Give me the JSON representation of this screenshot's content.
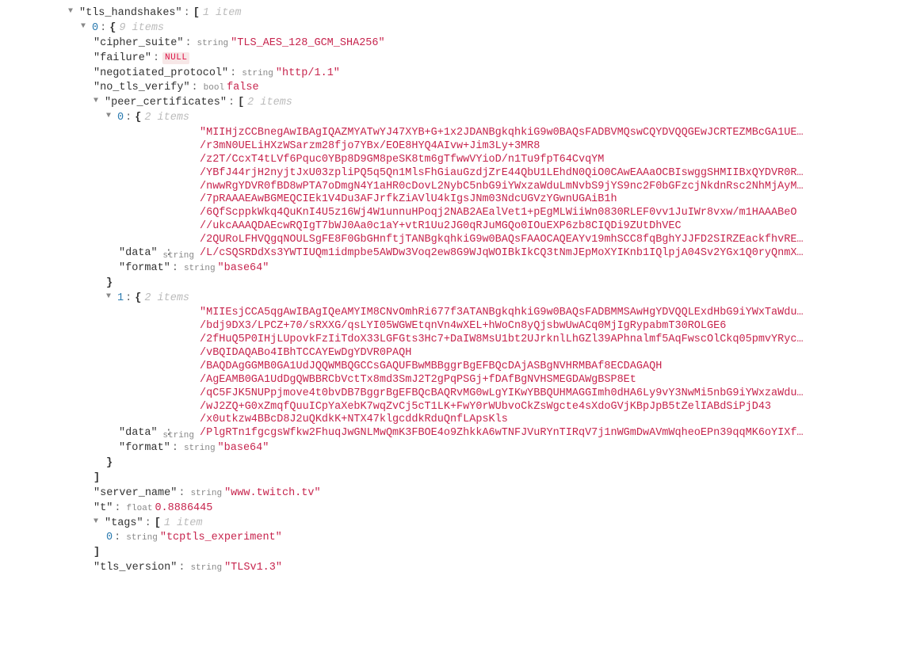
{
  "root": {
    "key": "tls_handshakes",
    "count": "1 item",
    "item0": {
      "idx": "0",
      "count": "9 items",
      "cipher_suite": {
        "key": "cipher_suite",
        "type": "string",
        "val": "TLS_AES_128_GCM_SHA256"
      },
      "failure": {
        "key": "failure",
        "type": "NULL"
      },
      "negotiated_protocol": {
        "key": "negotiated_protocol",
        "type": "string",
        "val": "http/1.1"
      },
      "no_tls_verify": {
        "key": "no_tls_verify",
        "type": "bool",
        "val": "false"
      },
      "peer_certs": {
        "key": "peer_certificates",
        "count": "2 items",
        "c0": {
          "idx": "0",
          "count": "2 items",
          "data_lines": [
            "\"MIIHjzCCBnegAwIBAgIQAZMYATwYJ47XYB+G+1x2JDANBgkqhkiG9w0BAQsFADBVMQswCQYDVQQGEwJCRTEZMBcGA1UE…",
            "/r3mN0UELiHXzWSarzm28fjo7YBx/EOE8HYQ4AIvw+Jim3Ly+3MR8",
            "/z2T/CcxT4tLVf6Pquc0YBp8D9GM8peSK8tm6gTfwwVYioD/n1Tu9fpT64CvqYM",
            "/YBfJ44rjH2nyjtJxU03zpliPQ5q5Qn1MlsFhGiauGzdjZrE44QbU1LEhdN0QiO0CAwEAAaOCBIswggSHMIIBxQYDVR0R…",
            "/nwwRgYDVR0fBD8wPTA7oDmgN4Y1aHR0cDovL2NybC5nbG9iYWxzaWduLmNvbS9jYS9nc2F0bGFzcjNkdnRsc2NhMjAyM…",
            "/7pRAAAEAwBGMEQCIEk1V4Du3AFJrfkZiAVlU4kIgsJNm03NdcUGVzYGwnUGAiB1h",
            "/6QfScppkWkq4QuKnI4U5z16Wj4W1unnuHPoqj2NAB2AEalVet1+pEgMLWiiWn0830RLEF0vv1JuIWr8vxw/m1HAAABeO",
            "//ukcAAAQDAEcwRQIgT7bWJ0Aa0c1aY+vtR1Uu2JG0qRJuMGQo0IOuEXP6zb8CIQDi9ZUtDhVEC",
            "/2QURoLFHVQgqNOULSgFE8F0GbGHnftjTANBgkqhkiG9w0BAQsFAAOCAQEAYv19mhSCC8fqBghYJJFD2SIRZEackfhvRE…",
            "/L/cSQSRDdXs3YWTIUQm1idmpbe5AWDw3Voq2ew8G9WJqWOIBkIkCQ3tNmJEpMoXYIKnb1IQlpjA04Sv2YGx1Q0ryQnmX…"
          ],
          "data_key": "data",
          "type": "string",
          "format": {
            "key": "format",
            "type": "string",
            "val": "base64"
          }
        },
        "c1": {
          "idx": "1",
          "count": "2 items",
          "data_lines": [
            "\"MIIEsjCCA5qgAwIBAgIQeAMYIM8CNvOmhRi677f3ATANBgkqhkiG9w0BAQsFADBMMSAwHgYDVQQLExdHbG9iYWxTaWdu…",
            "/bdj9DX3/LPCZ+70/sRXXG/qsLYI05WGWEtqnVn4wXEL+hWoCn8yQjsbwUwACq0MjIgRypabmT30ROLGE6",
            "/2fHuQ5P0IHjLUpovkFzIiTdoX33LGFGts3Hc7+DaIW8MsU1bt2UJrknlLhGZl39APhnalmf5AqFwscOlCkq05pmvYRyc…",
            "/vBQIDAQABo4IBhTCCAYEwDgYDVR0PAQH",
            "/BAQDAgGGMB0GA1UdJQQWMBQGCCsGAQUFBwMBBggrBgEFBQcDAjASBgNVHRMBAf8ECDAGAQH",
            "/AgEAMB0GA1UdDgQWBBRCbVctTx8md3SmJ2T2gPqPSGj+fDAfBgNVHSMEGDAWgBSP8Et",
            "/qC5FJK5NUPpjmove4t0bvDB7BggrBgEFBQcBAQRvMG0wLgYIKwYBBQUHMAGGImh0dHA6Ly9vY3NwMi5nbG9iYWxzaWdu…",
            "/wJ2ZQ+G0xZmqfQuuICpYaXebK7wqZvCj5cT1LK+FwY0rWUbvoCkZsWgcte4sXdoGVjKBpJpB5tZelIABdSiPjD43",
            "/x0utkzw4BBcD8J2uQKdkK+NTX47klgcddkRduQnfLApsKls",
            "/PlgRTn1fgcgsWfkw2FhuqJwGNLMwQmK3FBOE4o9ZhkkA6wTNFJVuRYnTIRqV7j1nWGmDwAVmWqheoEPn39qqMK6oYIXf…"
          ],
          "data_key": "data",
          "type": "string",
          "format": {
            "key": "format",
            "type": "string",
            "val": "base64"
          }
        }
      },
      "server_name": {
        "key": "server_name",
        "type": "string",
        "val": "www.twitch.tv"
      },
      "t": {
        "key": "t",
        "type": "float",
        "val": "0.8886445"
      },
      "tags": {
        "key": "tags",
        "count": "1 item",
        "item": {
          "idx": "0",
          "type": "string",
          "val": "tcptls_experiment"
        }
      },
      "tls_version": {
        "key": "tls_version",
        "type": "string",
        "val": "TLSv1.3"
      }
    }
  }
}
